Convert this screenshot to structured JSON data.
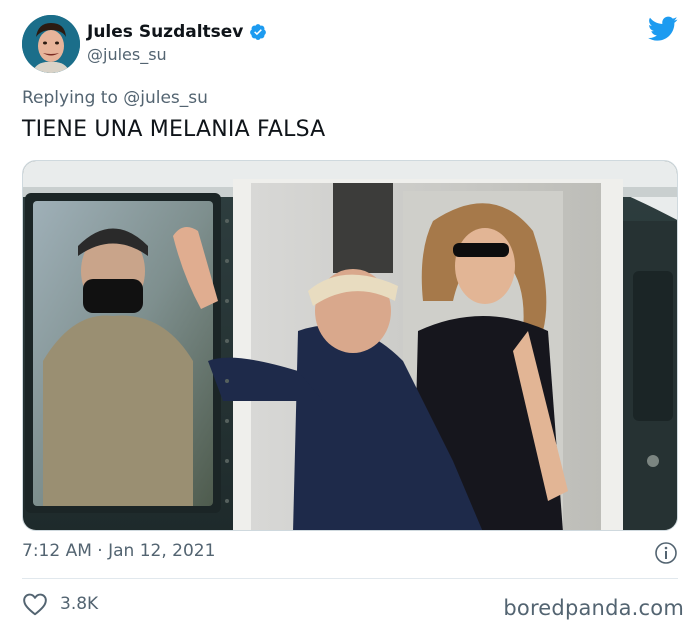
{
  "author": {
    "display_name": "Jules Suzdaltsev",
    "handle": "@jules_su",
    "verified_icon": "verified-badge-icon",
    "avatar_icon": "avatar"
  },
  "platform_icon": "twitter-bird-icon",
  "reply": {
    "prefix": "Replying to",
    "handle": "@jules_su"
  },
  "tweet": {
    "text": "TIENE UNA MELANIA FALSA",
    "timestamp": "7:12 AM · Jan 12, 2021",
    "likes": "3.8K"
  },
  "icons": {
    "info": "info-icon",
    "like": "heart-icon"
  },
  "colors": {
    "twitter_blue": "#1d9bf0",
    "text_primary": "#0f1419",
    "text_secondary": "#536471",
    "divider": "#e1e8ed"
  },
  "watermark": "boredpanda.com"
}
